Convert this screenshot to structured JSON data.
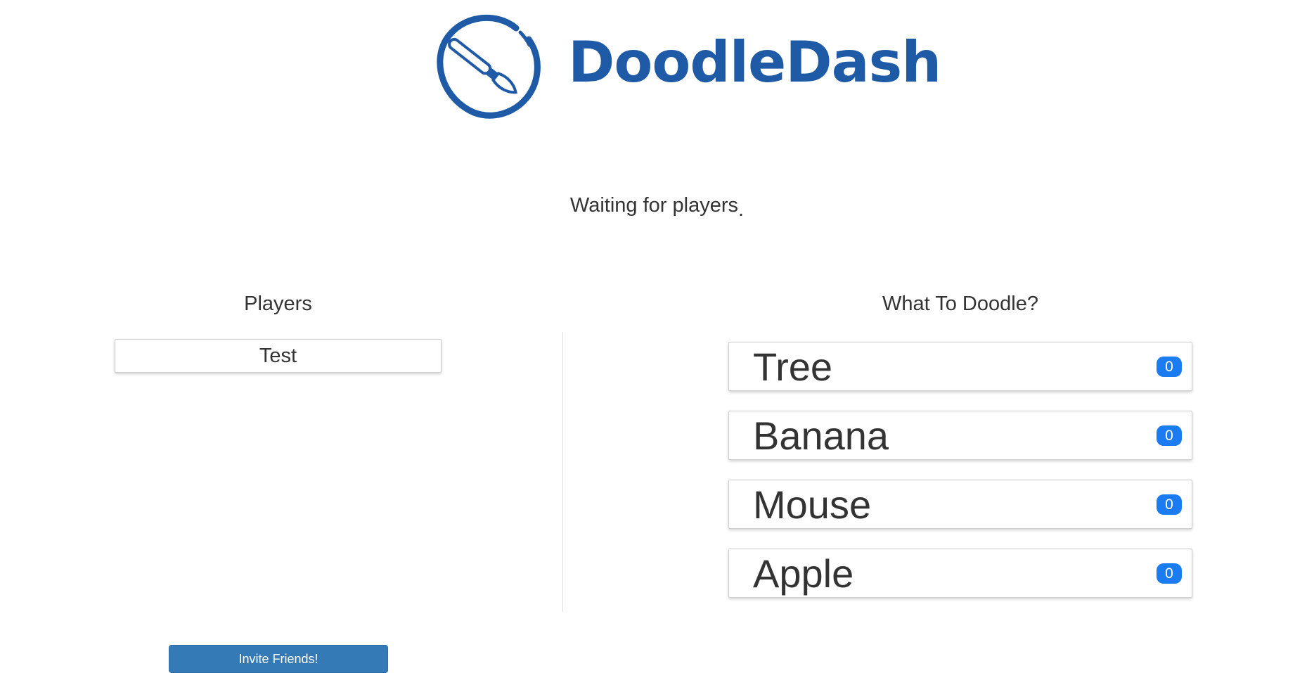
{
  "header": {
    "app_name": "DoodleDash",
    "logo_icon": "paintbrush-circle-icon",
    "brand_color": "#1f5aa6"
  },
  "status": {
    "text": "Waiting for players",
    "dots": "."
  },
  "players": {
    "heading": "Players",
    "items": [
      {
        "name": "Test"
      }
    ]
  },
  "doodle": {
    "heading": "What To Doodle?",
    "badge_color": "#1a7cf0",
    "items": [
      {
        "word": "Tree",
        "count": "0"
      },
      {
        "word": "Banana",
        "count": "0"
      },
      {
        "word": "Mouse",
        "count": "0"
      },
      {
        "word": "Apple",
        "count": "0"
      }
    ]
  },
  "actions": {
    "invite_label": "Invite Friends!",
    "button_color": "#337ab7"
  }
}
